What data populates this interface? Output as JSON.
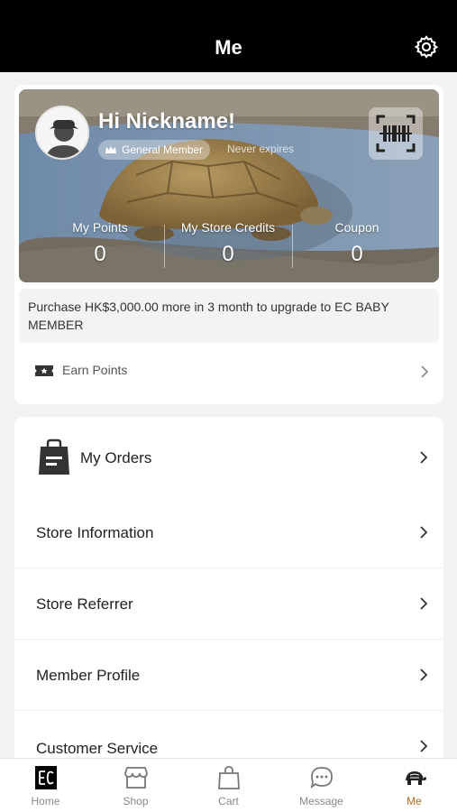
{
  "header": {
    "title": "Me",
    "settings_icon": "gear-icon"
  },
  "profile": {
    "greeting": "Hi Nickname!",
    "membership": "General Member",
    "expiry": "Never expires",
    "stats": [
      {
        "label": "My Points",
        "value": "0"
      },
      {
        "label": "My Store Credits",
        "value": "0"
      },
      {
        "label": "Coupon",
        "value": "0"
      }
    ],
    "upgrade_message": "Purchase HK$3,000.00 more in 3 month to upgrade to EC BABY MEMBER",
    "earn_points": "Earn Points"
  },
  "menu": {
    "items": [
      {
        "label": "My Orders"
      },
      {
        "label": "Store Information"
      },
      {
        "label": "Store Referrer"
      },
      {
        "label": "Member Profile"
      },
      {
        "label": "Customer Service"
      }
    ]
  },
  "tabbar": {
    "tabs": [
      {
        "label": "Home"
      },
      {
        "label": "Shop"
      },
      {
        "label": "Cart"
      },
      {
        "label": "Message"
      },
      {
        "label": "Me"
      }
    ],
    "active_color": "#b06a1c"
  }
}
